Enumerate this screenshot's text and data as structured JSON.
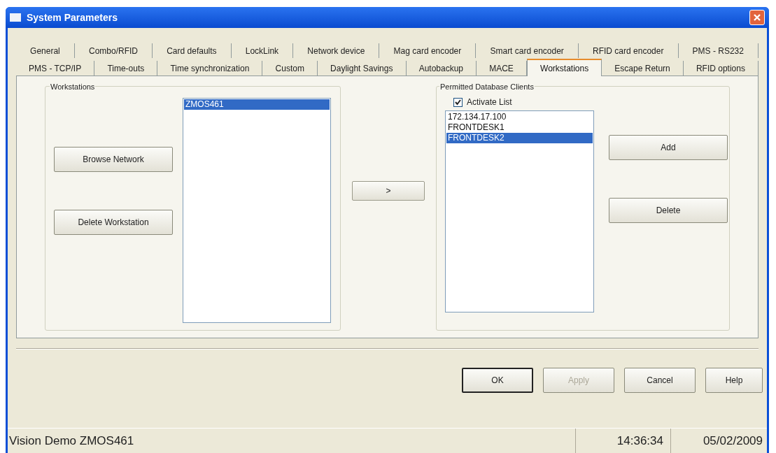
{
  "window": {
    "title": "System Parameters"
  },
  "tab_rows": [
    [
      {
        "label": "General",
        "selected": false
      },
      {
        "label": "Combo/RFID",
        "selected": false
      },
      {
        "label": "Card defaults",
        "selected": false
      },
      {
        "label": "LockLink",
        "selected": false
      },
      {
        "label": "Network device",
        "selected": false
      },
      {
        "label": "Mag card encoder",
        "selected": false
      },
      {
        "label": "Smart card encoder",
        "selected": false
      },
      {
        "label": "RFID card encoder",
        "selected": false
      },
      {
        "label": "PMS - RS232",
        "selected": false
      }
    ],
    [
      {
        "label": "PMS - TCP/IP",
        "selected": false
      },
      {
        "label": "Time-outs",
        "selected": false
      },
      {
        "label": "Time synchronization",
        "selected": false
      },
      {
        "label": "Custom",
        "selected": false
      },
      {
        "label": "Daylight Savings",
        "selected": false
      },
      {
        "label": "Autobackup",
        "selected": false
      },
      {
        "label": "MACE",
        "selected": false
      },
      {
        "label": "Workstations",
        "selected": true
      },
      {
        "label": "Escape Return",
        "selected": false
      },
      {
        "label": "RFID options",
        "selected": false
      }
    ]
  ],
  "workstations": {
    "title": "Workstations",
    "buttons": [
      "Browse Network",
      "Delete Workstation"
    ],
    "items": [
      {
        "label": "ZMOS461",
        "selected": true
      }
    ]
  },
  "transfer_button": ">",
  "permitted_clients": {
    "title": "Permitted Database Clients",
    "activate_list": {
      "label": "Activate List",
      "checked": true
    },
    "items": [
      {
        "label": "172.134.17.100",
        "selected": false
      },
      {
        "label": "FRONTDESK1",
        "selected": false
      },
      {
        "label": "FRONTDESK2",
        "selected": true
      }
    ],
    "buttons": [
      "Add",
      "Delete"
    ]
  },
  "dialog_buttons": [
    {
      "label": "OK",
      "disabled": false,
      "default": true
    },
    {
      "label": "Apply",
      "disabled": true,
      "default": false
    },
    {
      "label": "Cancel",
      "disabled": false,
      "default": false
    },
    {
      "label": "Help",
      "disabled": false,
      "default": false
    }
  ],
  "status_bar": {
    "text": "Vision Demo ZMOS461",
    "time": "14:36:34",
    "date": "05/02/2009"
  }
}
